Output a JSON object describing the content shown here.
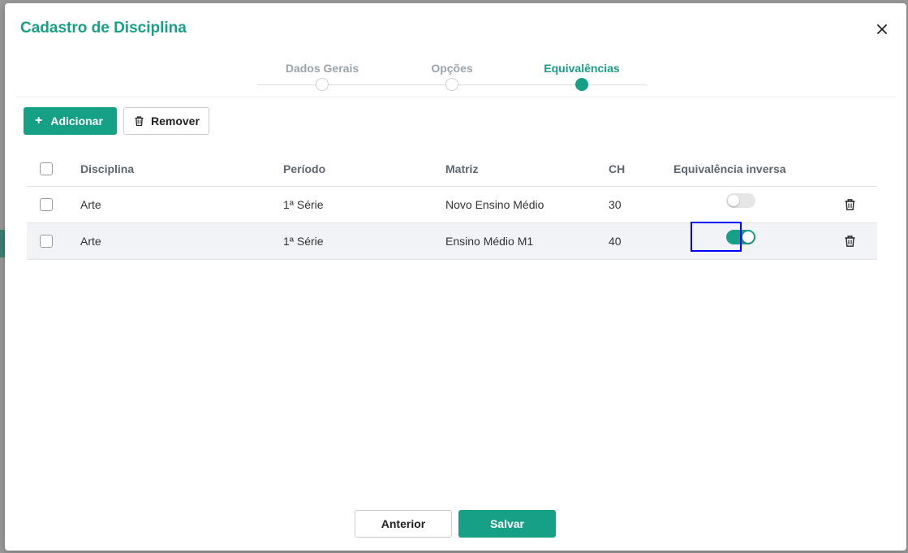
{
  "modal": {
    "title": "Cadastro de Disciplina",
    "close_glyph": "×"
  },
  "stepper": {
    "steps": [
      {
        "label": "Dados Gerais",
        "active": false
      },
      {
        "label": "Opções",
        "active": false
      },
      {
        "label": "Equivalências",
        "active": true
      }
    ]
  },
  "toolbar": {
    "add_label": "Adicionar",
    "remove_label": "Remover"
  },
  "table": {
    "columns": [
      "Disciplina",
      "Período",
      "Matriz",
      "CH",
      "Equivalência inversa"
    ],
    "rows": [
      {
        "disciplina": "Arte",
        "periodo": "1ª Série",
        "matriz": "Novo Ensino Médio",
        "ch": "30",
        "equivalencia_inversa": false
      },
      {
        "disciplina": "Arte",
        "periodo": "1ª Série",
        "matriz": "Ensino Médio M1",
        "ch": "40",
        "equivalencia_inversa": true
      }
    ]
  },
  "footer": {
    "prev_label": "Anterior",
    "save_label": "Salvar"
  },
  "colors": {
    "accent": "#16a085",
    "focus": "#0000ff"
  }
}
